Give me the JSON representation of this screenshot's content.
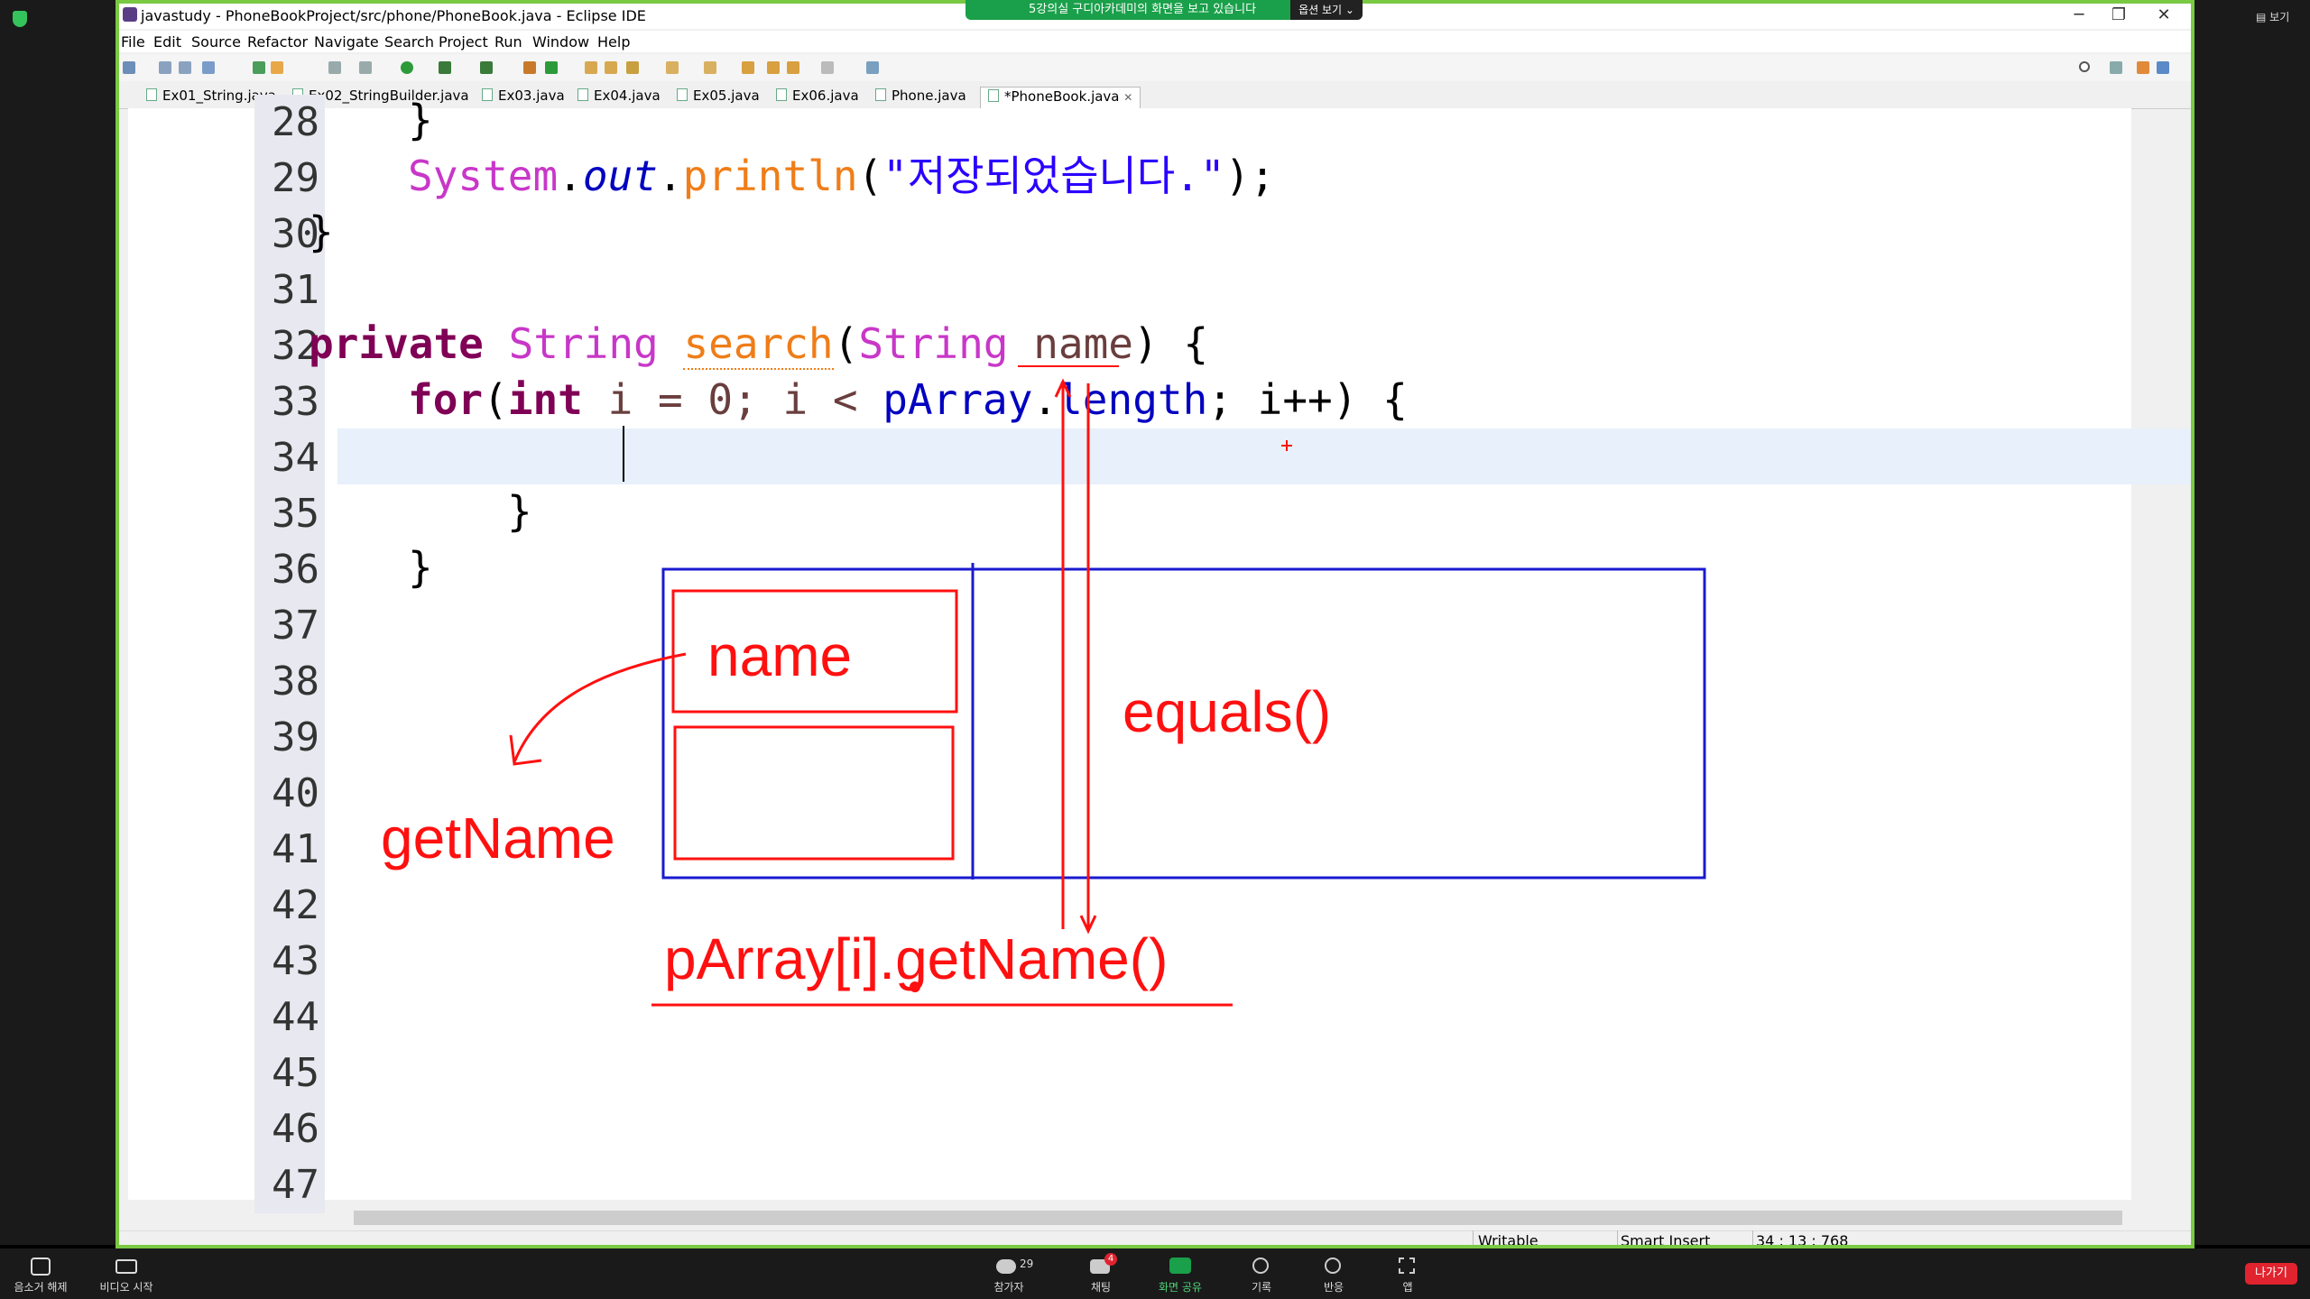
{
  "window": {
    "title": "javastudy - PhoneBookProject/src/phone/PhoneBook.java - Eclipse IDE",
    "minimize": "─",
    "restore": "❐",
    "close": "✕"
  },
  "menu": [
    "File",
    "Edit",
    "Source",
    "Refactor",
    "Navigate",
    "Search",
    "Project",
    "Run",
    "Window",
    "Help"
  ],
  "tabs": [
    "Ex01_String.java",
    "Ex02_StringBuilder.java",
    "Ex03.java",
    "Ex04.java",
    "Ex05.java",
    "Ex06.java",
    "Phone.java",
    "*PhoneBook.java"
  ],
  "active_tab_close": "✕",
  "line_numbers": [
    "28",
    "29",
    "30",
    "31",
    "32",
    "33",
    "34",
    "35",
    "36",
    "37",
    "38",
    "39",
    "40",
    "41",
    "42",
    "43",
    "44",
    "45",
    "46",
    "47"
  ],
  "code": {
    "l28": "}",
    "l29_system": "System",
    "l29_dot1": ".",
    "l29_out": "out",
    "l29_dot2": ".",
    "l29_println": "println",
    "l29_open": "(",
    "l29_str": "\"저장되었습니다.\"",
    "l29_close": ");",
    "l30": "}",
    "l32_private": "private",
    "l32_string": "String",
    "l32_search": "search",
    "l32_paren": "(",
    "l32_string2": "String",
    "l32_name": "name",
    "l32_rest": ") {",
    "l33_for": "for",
    "l33_paren": "(",
    "l33_int": "int",
    "l33_mid": " i = 0; i < ",
    "l33_parray": "pArray",
    "l33_dot": ".",
    "l33_length": "length",
    "l33_rest": "; i++) {",
    "l35": "}",
    "l36": "}"
  },
  "annotations": {
    "name_box": "name",
    "equals": "equals()",
    "getname": "getName",
    "parray_call": "pArray[i].getName()"
  },
  "status": {
    "writable": "Writable",
    "insert_mode": "Smart Insert",
    "position": "34 : 13 : 768"
  },
  "zoom": {
    "share_banner": "5강의실 구디아카데미의 화면을 보고 있습니다",
    "options": "옵션 보기 ⌄",
    "view": "▤ 보기",
    "mute": "음소거 해제",
    "video": "비디오 시작",
    "participants": "참가자",
    "participants_count": "29",
    "chat": "채팅",
    "chat_badge": "4",
    "share": "화면 공유",
    "record": "기록",
    "reactions": "반응",
    "apps": "앱",
    "leave": "나가기"
  },
  "colors": {
    "keyword": "#7f0055",
    "type": "#c837c8",
    "method": "#ef7d18",
    "string": "#2a00ff",
    "annotation_red": "#ff1010",
    "annotation_blue": "#1a1ad0",
    "share_green": "#7ac943"
  }
}
